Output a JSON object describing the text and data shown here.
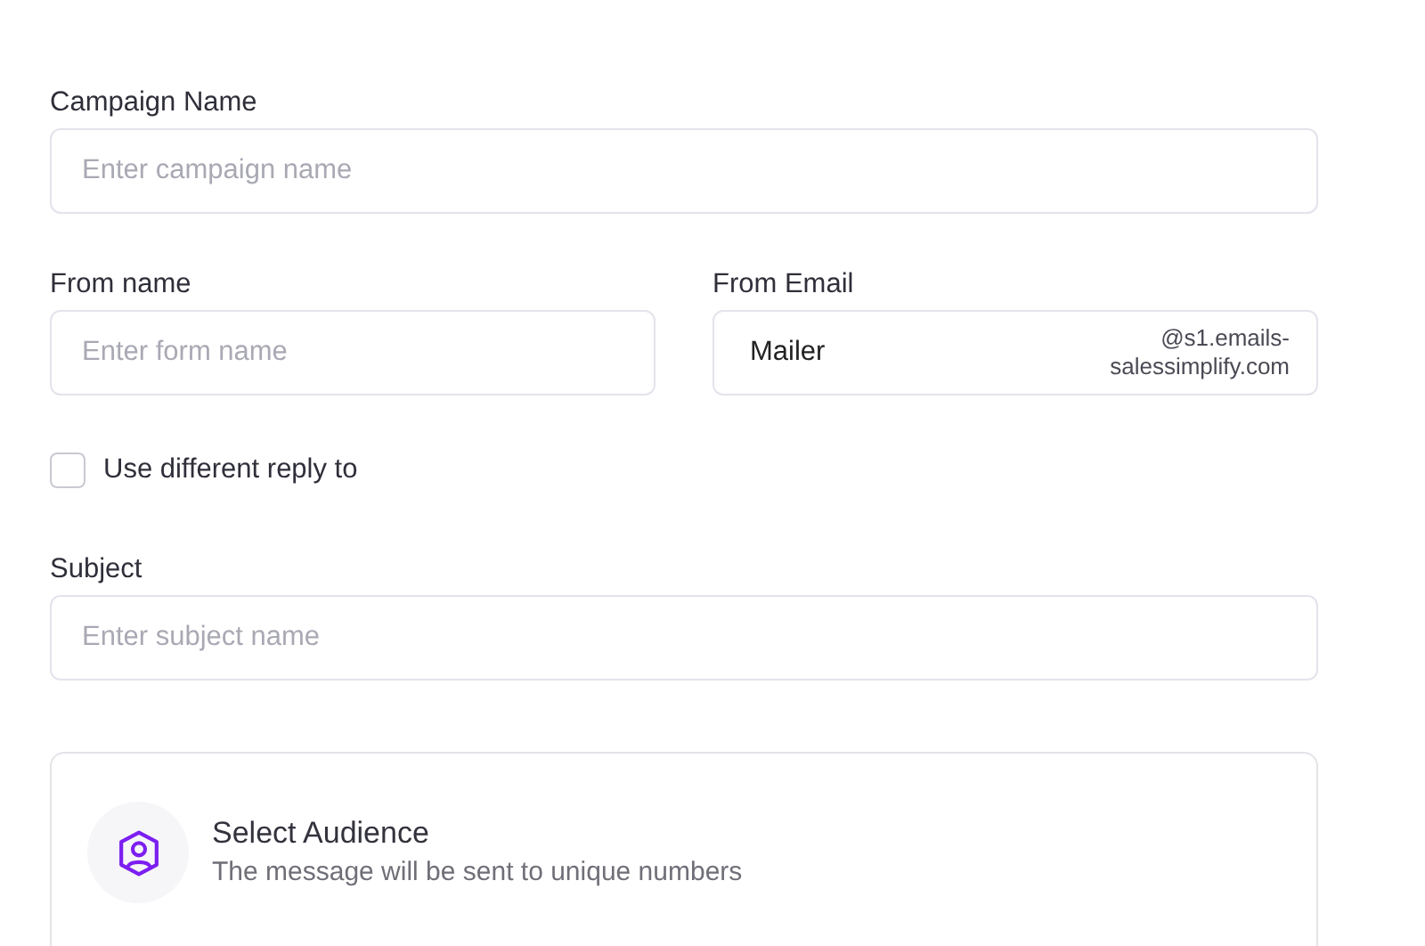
{
  "campaign_name": {
    "label": "Campaign Name",
    "placeholder": "Enter campaign name"
  },
  "from_name": {
    "label": "From name",
    "placeholder": "Enter form name"
  },
  "from_email": {
    "label": "From Email",
    "value": "Mailer",
    "domain_line_1": "@s1.emails-",
    "domain_line_2": "salessimplify.com"
  },
  "different_reply": {
    "label": "Use different reply to",
    "checked": false
  },
  "subject": {
    "label": "Subject",
    "placeholder": "Enter subject name"
  },
  "audience": {
    "title": "Select Audience",
    "description": "The message will be sent to unique numbers"
  }
}
